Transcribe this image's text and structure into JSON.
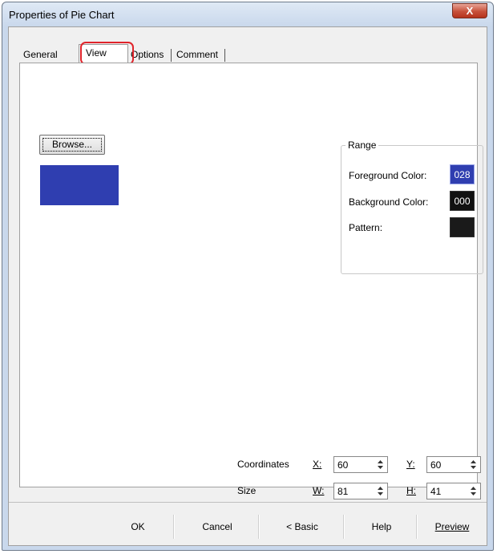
{
  "window": {
    "title": "Properties of Pie Chart",
    "close_glyph": "X"
  },
  "tabs": [
    {
      "label": "General"
    },
    {
      "label": "View"
    },
    {
      "label": "Options"
    },
    {
      "label": "Comment"
    }
  ],
  "active_tab": "View",
  "view": {
    "browse_label": "Browse...",
    "preview_color": "#2f3eb0",
    "range": {
      "title": "Range",
      "foreground_label": "Foreground Color:",
      "foreground_value": "028",
      "foreground_color": "#2f3eb0",
      "background_label": "Background Color:",
      "background_value": "000",
      "background_color": "#111111",
      "pattern_label": "Pattern:"
    },
    "coordinates": {
      "label": "Coordinates",
      "x_label": "X:",
      "x": "60",
      "y_label": "Y:",
      "y": "60"
    },
    "size": {
      "label": "Size",
      "w_label": "W:",
      "w": "81",
      "h_label": "H:",
      "h": "41"
    }
  },
  "buttons": {
    "ok": "OK",
    "cancel": "Cancel",
    "basic": "< Basic",
    "help": "Help",
    "preview": "Preview"
  }
}
